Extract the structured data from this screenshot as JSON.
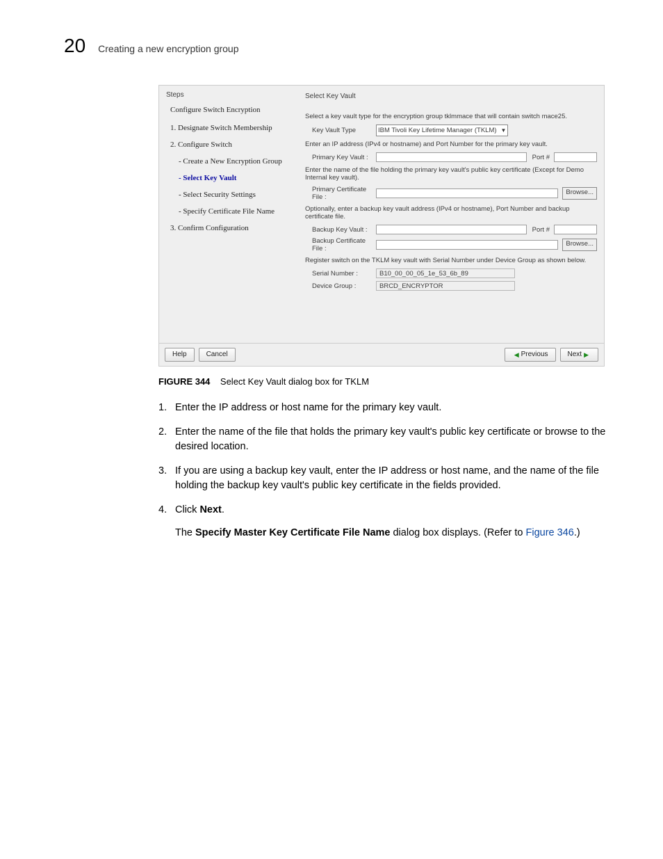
{
  "header": {
    "page_number": "20",
    "page_title": "Creating a new encryption group"
  },
  "dialog": {
    "left": {
      "steps_label": "Steps",
      "title": "Configure Switch Encryption",
      "step1": "1. Designate Switch Membership",
      "step2": "2. Configure Switch",
      "sub_create": "- Create a New Encryption Group",
      "sub_select": "- Select Key Vault",
      "sub_security": "- Select Security Settings",
      "sub_specify": "- Specify Certificate File Name",
      "step3": "3. Confirm Configuration"
    },
    "right": {
      "title": "Select Key Vault",
      "instr1": "Select a key vault type for the encryption group tklmmace that will contain switch mace25.",
      "key_vault_type_label": "Key Vault Type",
      "key_vault_type_value": "IBM Tivoli Key Lifetime Manager (TKLM)",
      "instr2": "Enter an IP address (IPv4 or hostname) and Port Number for the primary key vault.",
      "primary_key_vault_label": "Primary Key Vault :",
      "port_label": "Port #",
      "instr3": "Enter the name of the file holding the primary key vault's public key certificate (Except for Demo Internal key vault).",
      "primary_cert_label": "Primary Certificate File :",
      "browse": "Browse...",
      "instr4": "Optionally, enter a backup key vault address (IPv4 or hostname), Port Number and backup certificate file.",
      "backup_key_vault_label": "Backup Key Vault :",
      "backup_cert_label": "Backup Certificate File :",
      "instr5": "Register switch on the TKLM key vault with Serial Number under Device Group as shown below.",
      "serial_number_label": "Serial Number :",
      "serial_number_value": "B10_00_00_05_1e_53_6b_89",
      "device_group_label": "Device Group :",
      "device_group_value": "BRCD_ENCRYPTOR"
    },
    "footer": {
      "help": "Help",
      "cancel": "Cancel",
      "previous": "Previous",
      "next": "Next"
    }
  },
  "caption": {
    "label": "FIGURE 344",
    "text": "Select Key Vault dialog box for TKLM"
  },
  "steps": {
    "s1_num": "1.",
    "s1": "Enter the IP address or host name for the primary key vault.",
    "s2_num": "2.",
    "s2": "Enter the name of the file that holds the primary key vault's public key certificate or browse to the desired location.",
    "s3_num": "3.",
    "s3": "If you are using a backup key vault, enter the IP address or host name, and the name of the file holding the backup key vault's public key certificate in the fields provided.",
    "s4_num": "4.",
    "s4_pre": "Click ",
    "s4_bold": "Next",
    "s4_post": ".",
    "s4_sub_pre": "The ",
    "s4_sub_bold": "Specify Master Key Certificate File Name",
    "s4_sub_mid": " dialog box displays. (Refer to ",
    "s4_sub_link": "Figure 346",
    "s4_sub_end": ".)"
  }
}
